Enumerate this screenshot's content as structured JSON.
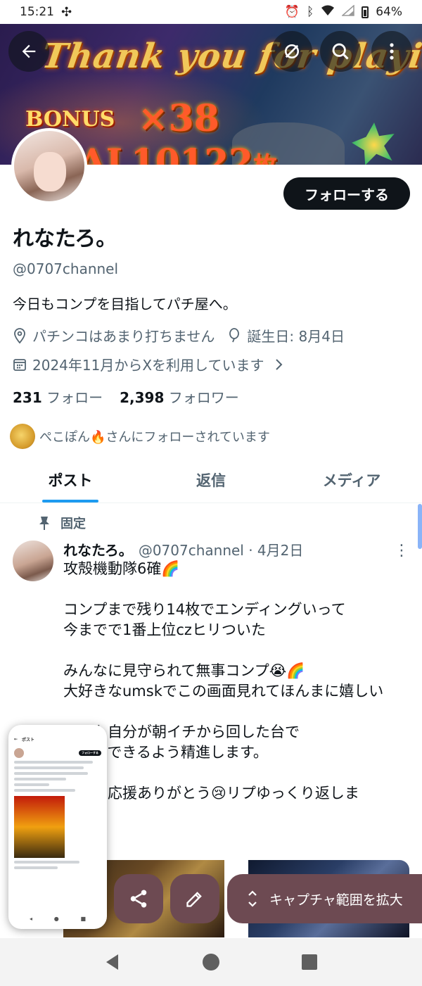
{
  "status_bar": {
    "time": "15:21",
    "battery": "64%"
  },
  "banner": {
    "line1": "Thank you for playing",
    "bonus": "BONUS",
    "multiplier": "×38",
    "total": "AL10122",
    "total_unit": "枚"
  },
  "profile": {
    "follow_label": "フォローする",
    "name": "れなたろ。",
    "handle": "@0707channel",
    "bio": "今日もコンプを目指してパチ屋へ。",
    "location": "パチンコはあまり打ちません",
    "birthday": "誕生日: 8月4日",
    "joined": "2024年11月からXを利用しています",
    "following_count": "231",
    "following_label": "フォロー",
    "followers_count": "2,398",
    "followers_label": "フォロワー",
    "followed_by": "ぺこぽん🔥さんにフォローされています"
  },
  "tabs": [
    {
      "label": "ポスト",
      "active": true
    },
    {
      "label": "返信",
      "active": false
    },
    {
      "label": "メディア",
      "active": false
    }
  ],
  "post": {
    "pinned_label": "固定",
    "author": "れなたろ。",
    "meta": "@0707channel · 4月2日",
    "more": "⋮",
    "body": "攻殻機動隊6確🌈\n\nコンプまで残り14枚でエンディングいって\n今までで1番上位czヒリついた\n\nみんなに見守られて無事コンプ😭🌈\n大好きなumskでこの画面見れてほんまに嬉しい\n\n明日も自分が朝イチから回した台で\nコンプできるよう精進します。\n\nいつも応援ありがとう😢リプゆっくり返しま"
  },
  "screenshot_toolbar": {
    "capture_label": "キャプチャ範囲を拡大"
  },
  "thumbnail": {
    "title": "ポスト",
    "follow": "フォローする"
  },
  "colors": {
    "accent": "#1d9bf0",
    "follow_bg": "#0f1419",
    "toolbar_bg": "#6d4a52",
    "secondary_text": "#536471"
  }
}
